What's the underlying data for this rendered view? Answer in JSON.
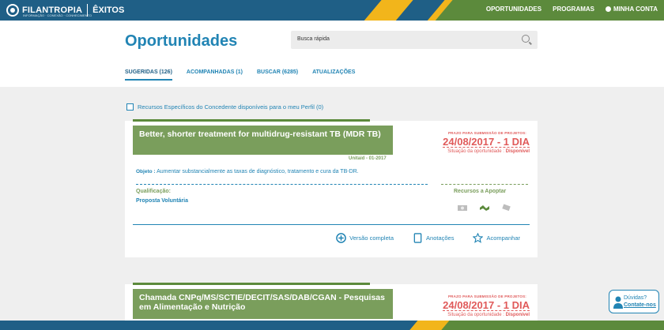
{
  "topbar": {
    "logo": "FILANTROPIA",
    "logo_sub": "INFORMAÇÃO · CONEXÃO · CONHECIMENTO",
    "logo_exitos": "ÊXITOS",
    "nav": [
      "OPORTUNIDADES",
      "PROGRAMAS",
      "MINHA CONTA"
    ]
  },
  "header": {
    "title": "Oportunidades",
    "search_placeholder": "Busca rápida",
    "tabs": [
      "SUGERIDAS (126)",
      "ACOMPANHADAS (1)",
      "BUSCAR (6285)",
      "ATUALIZAÇÕES"
    ]
  },
  "filter": {
    "label": "Recursos Específicos do Concedente disponíveis para o meu Perfil (0)"
  },
  "cards": [
    {
      "title": "Better, shorter treatment for multidrug-resistant TB (MDR TB)",
      "deadline_label": "PRAZO PARA SUBMISSÃO DE PROJETOS:",
      "deadline": "24/08/2017 - 1 DIA",
      "status_label": "Situação da oportunidade :",
      "status_value": "Disponível",
      "source": "Unitaid - 01-2017",
      "objeto_label": "Objeto :",
      "objeto_value": "Aumentar substancialmente as taxas de diagnóstico, tratamento e cura da TB-DR.",
      "qualificacao_label": "Qualificação:",
      "qualificacao_value": "Proposta Voluntária",
      "recursos_label": "Recursos a Apoptar",
      "actions": [
        "Versão completa",
        "Anotações",
        "Acompanhar"
      ]
    },
    {
      "title": "Chamada CNPq/MS/SCTIE/DECIT/SAS/DAB/CGAN - Pesquisas em Alimentação e Nutrição",
      "deadline_label": "PRAZO PARA SUBMISSÃO DE PROJETOS:",
      "deadline": "24/08/2017 - 1 DIA",
      "status_label": "Situação da oportunidade :",
      "status_value": "Disponível"
    }
  ],
  "help": {
    "line1": "Dúvidas?",
    "line2": "Contate-nos"
  }
}
